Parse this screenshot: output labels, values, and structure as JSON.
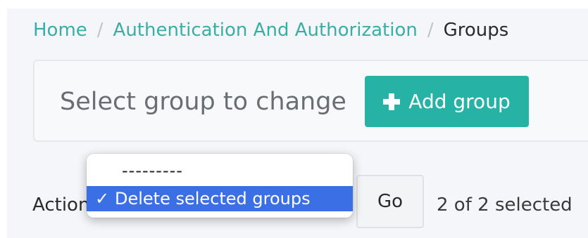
{
  "breadcrumb": {
    "home": "Home",
    "separator": "/",
    "section": "Authentication And Authorization",
    "current": "Groups"
  },
  "card": {
    "title": "Select group to change",
    "add_button_label": "Add group"
  },
  "actions": {
    "label": "Action:",
    "go_label": "Go",
    "selected_count": "2 of 2 selected",
    "options": [
      {
        "label": "---------",
        "selected": false
      },
      {
        "label": "Delete selected groups",
        "selected": true
      }
    ],
    "check_glyph": "✓"
  },
  "colors": {
    "link": "#3aaea6",
    "primary_button": "#26b3a6",
    "dropdown_highlight": "#3b6fe6"
  },
  "icons": {
    "add": "plus-icon",
    "selected_option": "check-icon"
  }
}
